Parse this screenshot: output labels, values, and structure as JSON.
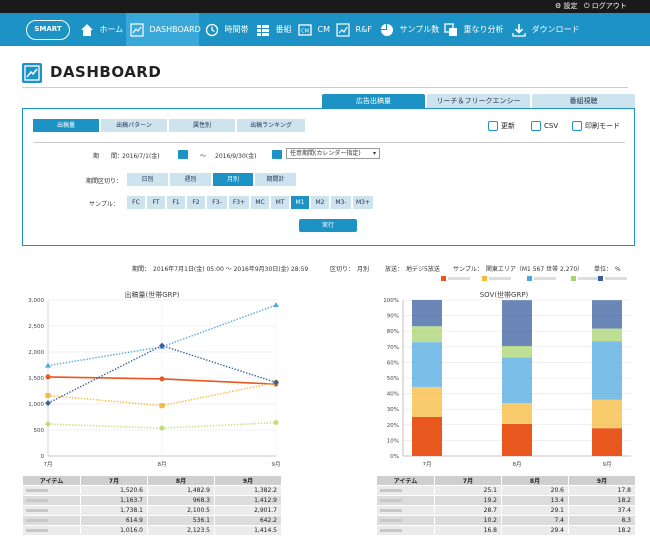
{
  "topbar": {
    "settings": "設定",
    "logout": "ログアウト"
  },
  "logo": "SMART",
  "nav": [
    {
      "label": "ホーム",
      "icon": "home-icon"
    },
    {
      "label": "DASHBOARD",
      "icon": "dashboard-icon",
      "active": true
    },
    {
      "label": "時間帯",
      "icon": "clock-icon"
    },
    {
      "label": "番組",
      "icon": "program-icon"
    },
    {
      "label": "CM",
      "icon": "cm-icon"
    },
    {
      "label": "R&F",
      "icon": "reach-frequency-icon"
    },
    {
      "label": "サンプル数",
      "icon": "pie-icon"
    },
    {
      "label": "重なり分析",
      "icon": "overlap-icon"
    },
    {
      "label": "ダウンロード",
      "icon": "download-icon"
    }
  ],
  "page_title": "DASHBOARD",
  "main_tabs": [
    {
      "label": "広告出稿量",
      "active": true
    },
    {
      "label": "リーチ＆フリークエンシー",
      "active": false
    },
    {
      "label": "番組視聴",
      "active": false
    }
  ],
  "sub_tabs": [
    {
      "label": "出稿量",
      "active": true
    },
    {
      "label": "出稿パターン",
      "active": false
    },
    {
      "label": "属性別",
      "active": false
    },
    {
      "label": "出稿ランキング",
      "active": false
    }
  ],
  "tools": {
    "refresh": "更新",
    "csv": "CSV",
    "print": "印刷モード"
  },
  "period": {
    "label": "期　　間：",
    "from": "2016/7/1(金)",
    "sep": "〜",
    "to": "2016/9/30(金)",
    "select": "任意期間(カレンダー指定)"
  },
  "split": {
    "label": "期間区切り：",
    "options": [
      {
        "label": "日別",
        "active": false
      },
      {
        "label": "週別",
        "active": false
      },
      {
        "label": "月別",
        "active": true
      },
      {
        "label": "期間計",
        "active": false
      }
    ]
  },
  "sample": {
    "label": "サンプル：",
    "options": [
      {
        "label": "FC",
        "active": false
      },
      {
        "label": "FT",
        "active": false
      },
      {
        "label": "F1",
        "active": false
      },
      {
        "label": "F2",
        "active": false
      },
      {
        "label": "F3-",
        "active": false
      },
      {
        "label": "F3+",
        "active": false
      },
      {
        "label": "MC",
        "active": false
      },
      {
        "label": "MT",
        "active": false
      },
      {
        "label": "M1",
        "active": true
      },
      {
        "label": "M2",
        "active": false
      },
      {
        "label": "M3-",
        "active": false
      },
      {
        "label": "M3+",
        "active": false
      }
    ]
  },
  "run_button": "実行",
  "info": {
    "period": "期間：　2016年7月1日(金) 05:00 〜 2016年9月30日(金) 28:59",
    "split": "区切り：　月別",
    "broadcast": "放送：　地デジ5放送",
    "sample": "サンプル：　関東エリア（M1 567 世帯 2,270）",
    "unit": "単位：　%"
  },
  "legend_colors": [
    "#e8571e",
    "#f6b93b",
    "#4fa8e0",
    "#a8d46f",
    "#3a5fa0"
  ],
  "chart_data": [
    {
      "type": "line",
      "title": "出稿量(世帯GRP)",
      "categories": [
        "7月",
        "8月",
        "9月"
      ],
      "ylim": [
        0,
        3000
      ],
      "yticks": [
        "0",
        "500",
        "1,000",
        "1,500",
        "2,000",
        "2,500",
        "3,000"
      ],
      "grid": true,
      "series": [
        {
          "values": [
            1520.6,
            1482.9,
            1382.2
          ],
          "color": "#e8571e"
        },
        {
          "values": [
            1163.7,
            968.3,
            1412.9
          ],
          "color": "#f6b93b"
        },
        {
          "values": [
            1738.1,
            2100.5,
            2901.7
          ],
          "color": "#4fa8e0"
        },
        {
          "values": [
            614.9,
            536.1,
            642.2
          ],
          "color": "#c5dd77"
        },
        {
          "values": [
            1016.0,
            2123.5,
            1414.5
          ],
          "color": "#3a5fa0"
        }
      ]
    },
    {
      "type": "bar",
      "stacked": true,
      "title": "SOV(世帯GRP)",
      "categories": [
        "7月",
        "8月",
        "9月"
      ],
      "ylim": [
        0,
        100
      ],
      "yticks": [
        "0%",
        "10%",
        "20%",
        "30%",
        "40%",
        "50%",
        "60%",
        "70%",
        "80%",
        "90%",
        "100%"
      ],
      "grid": true,
      "series": [
        {
          "values": [
            25.1,
            20.6,
            17.8
          ],
          "color": "#e8571e"
        },
        {
          "values": [
            19.2,
            13.4,
            18.2
          ],
          "color": "#f6b93b"
        },
        {
          "values": [
            28.7,
            29.1,
            37.4
          ],
          "color": "#4fa8e0"
        },
        {
          "values": [
            10.2,
            7.4,
            8.3
          ],
          "color": "#a8d46f"
        },
        {
          "values": [
            16.8,
            29.4,
            18.2
          ],
          "color": "#3a5fa0"
        }
      ]
    }
  ],
  "table_left": {
    "headers": [
      "アイテム",
      "7月",
      "8月",
      "9月"
    ],
    "rows": [
      [
        "1,520.6",
        "1,482.9",
        "1,382.2"
      ],
      [
        "1,163.7",
        "968.3",
        "1,412.9"
      ],
      [
        "1,738.1",
        "2,100.5",
        "2,901.7"
      ],
      [
        "614.9",
        "536.1",
        "642.2"
      ],
      [
        "1,016.0",
        "2,123.5",
        "1,414.5"
      ]
    ]
  },
  "table_right": {
    "headers": [
      "アイテム",
      "7月",
      "8月",
      "9月"
    ],
    "rows": [
      [
        "25.1",
        "20.6",
        "17.8"
      ],
      [
        "19.2",
        "13.4",
        "18.2"
      ],
      [
        "28.7",
        "29.1",
        "37.4"
      ],
      [
        "10.2",
        "7.4",
        "8.3"
      ],
      [
        "16.8",
        "29.4",
        "18.2"
      ]
    ]
  }
}
